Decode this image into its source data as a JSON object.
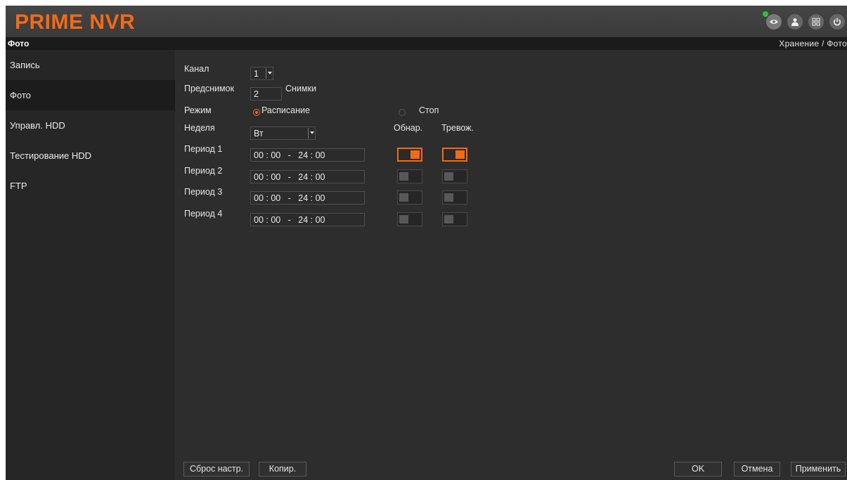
{
  "header": {
    "logo": "PRIME NVR",
    "icons": [
      "eye-icon",
      "user-icon",
      "multiscreen-icon",
      "power-icon"
    ],
    "status_dot_color": "#2cc13b",
    "accent": "#f36a17"
  },
  "breadcrumb": {
    "page_title": "Фото",
    "path": "Хранение  / Фото"
  },
  "sidebar": {
    "items": [
      {
        "label": "Запись",
        "active": false
      },
      {
        "label": "Фото",
        "active": true
      },
      {
        "label": "Управл. HDD",
        "active": false
      },
      {
        "label": "Тестирование HDD",
        "active": false
      },
      {
        "label": "FTP",
        "active": false
      }
    ]
  },
  "form": {
    "channel_label": "Канал",
    "channel_value": "1",
    "presnap_label": "Предснимок",
    "presnap_value": "2",
    "presnap_unit": "Снимки",
    "mode_label": "Режим",
    "mode_schedule": "Расписание",
    "mode_stop": "Стоп",
    "mode_selected": "schedule",
    "week_label": "Неделя",
    "week_value": "Вт",
    "col_detect": "Обнар.",
    "col_alarm": "Тревож.",
    "periods": [
      {
        "label": "Период 1",
        "sh": "00",
        "sm": "00",
        "sep": "-",
        "eh": "24",
        "em": "00",
        "detect": true,
        "alarm": true
      },
      {
        "label": "Период 2",
        "sh": "00",
        "sm": "00",
        "sep": "-",
        "eh": "24",
        "em": "00",
        "detect": false,
        "alarm": false
      },
      {
        "label": "Период 3",
        "sh": "00",
        "sm": "00",
        "sep": "-",
        "eh": "24",
        "em": "00",
        "detect": false,
        "alarm": false
      },
      {
        "label": "Период 4",
        "sh": "00",
        "sm": "00",
        "sep": "-",
        "eh": "24",
        "em": "00",
        "detect": false,
        "alarm": false
      }
    ]
  },
  "footer": {
    "reset_label": "Сброс настр.",
    "copy_label": "Копир.",
    "ok_label": "OK",
    "cancel_label": "Отмена",
    "apply_label": "Применить"
  }
}
